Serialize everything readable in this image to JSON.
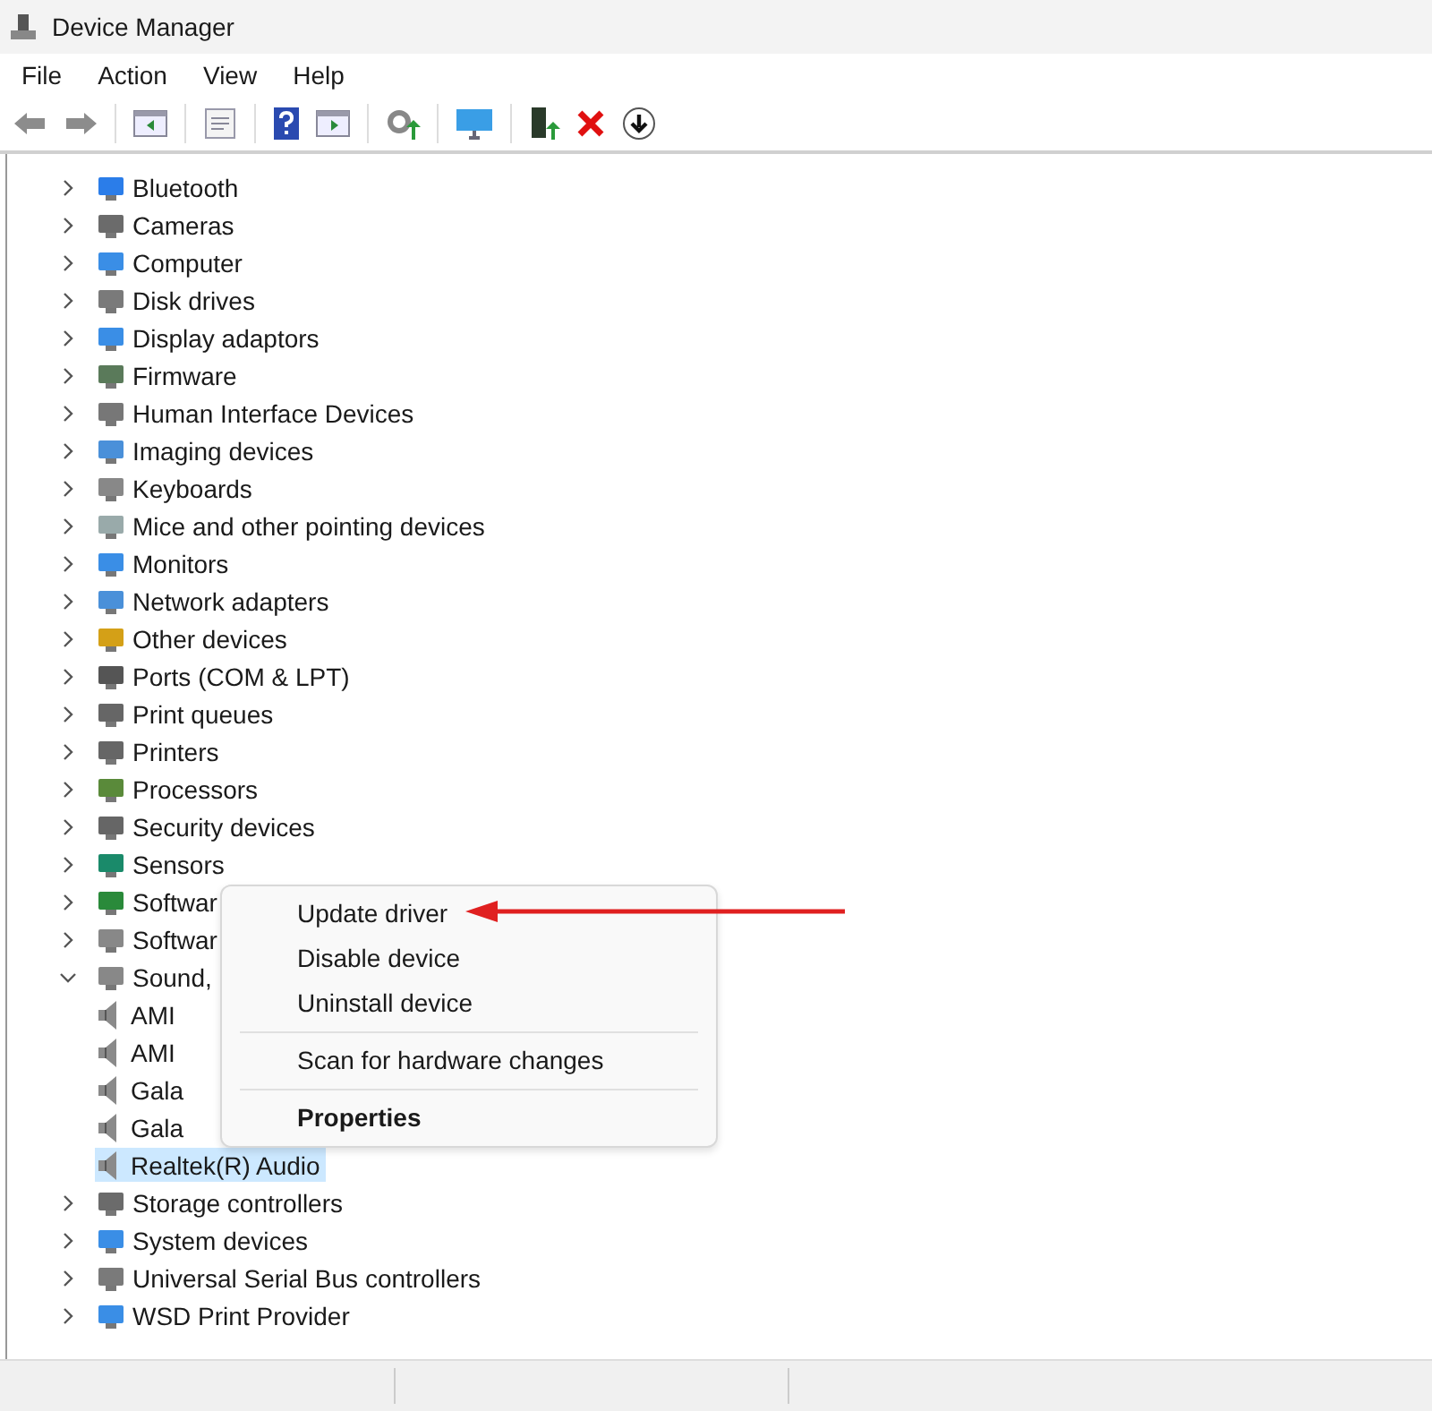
{
  "window": {
    "title": "Device Manager"
  },
  "menu": [
    "File",
    "Action",
    "View",
    "Help"
  ],
  "tree": [
    {
      "label": "Bluetooth",
      "expanded": false,
      "selected": false
    },
    {
      "label": "Cameras",
      "expanded": false,
      "selected": false
    },
    {
      "label": "Computer",
      "expanded": false,
      "selected": false
    },
    {
      "label": "Disk drives",
      "expanded": false,
      "selected": false
    },
    {
      "label": "Display adaptors",
      "expanded": false,
      "selected": false
    },
    {
      "label": "Firmware",
      "expanded": false,
      "selected": false
    },
    {
      "label": "Human Interface Devices",
      "expanded": false,
      "selected": false
    },
    {
      "label": "Imaging devices",
      "expanded": false,
      "selected": false
    },
    {
      "label": "Keyboards",
      "expanded": false,
      "selected": false
    },
    {
      "label": "Mice and other pointing devices",
      "expanded": false,
      "selected": false
    },
    {
      "label": "Monitors",
      "expanded": false,
      "selected": false
    },
    {
      "label": "Network adapters",
      "expanded": false,
      "selected": false
    },
    {
      "label": "Other devices",
      "expanded": false,
      "selected": false
    },
    {
      "label": "Ports (COM & LPT)",
      "expanded": false,
      "selected": false
    },
    {
      "label": "Print queues",
      "expanded": false,
      "selected": false
    },
    {
      "label": "Printers",
      "expanded": false,
      "selected": false
    },
    {
      "label": "Processors",
      "expanded": false,
      "selected": false
    },
    {
      "label": "Security devices",
      "expanded": false,
      "selected": false
    },
    {
      "label": "Sensors",
      "expanded": false,
      "selected": false
    },
    {
      "label": "Softwar",
      "expanded": false,
      "selected": false
    },
    {
      "label": "Softwar",
      "expanded": false,
      "selected": false
    },
    {
      "label": "Sound,",
      "expanded": true,
      "selected": false,
      "children": [
        {
          "label": "AMI",
          "selected": false
        },
        {
          "label": "AMI",
          "selected": false
        },
        {
          "label": "Gala",
          "selected": false
        },
        {
          "label": "Gala",
          "selected": false
        },
        {
          "label": "Realtek(R) Audio",
          "selected": true
        }
      ]
    },
    {
      "label": "Storage controllers",
      "expanded": false,
      "selected": false
    },
    {
      "label": "System devices",
      "expanded": false,
      "selected": false
    },
    {
      "label": "Universal Serial Bus controllers",
      "expanded": false,
      "selected": false
    },
    {
      "label": "WSD Print Provider",
      "expanded": false,
      "selected": false
    }
  ],
  "context_menu": [
    {
      "kind": "item",
      "label": "Update driver",
      "default": false
    },
    {
      "kind": "item",
      "label": "Disable device",
      "default": false
    },
    {
      "kind": "item",
      "label": "Uninstall device",
      "default": false
    },
    {
      "kind": "separator"
    },
    {
      "kind": "item",
      "label": "Scan for hardware changes",
      "default": false
    },
    {
      "kind": "separator"
    },
    {
      "kind": "item",
      "label": "Properties",
      "default": true
    }
  ]
}
